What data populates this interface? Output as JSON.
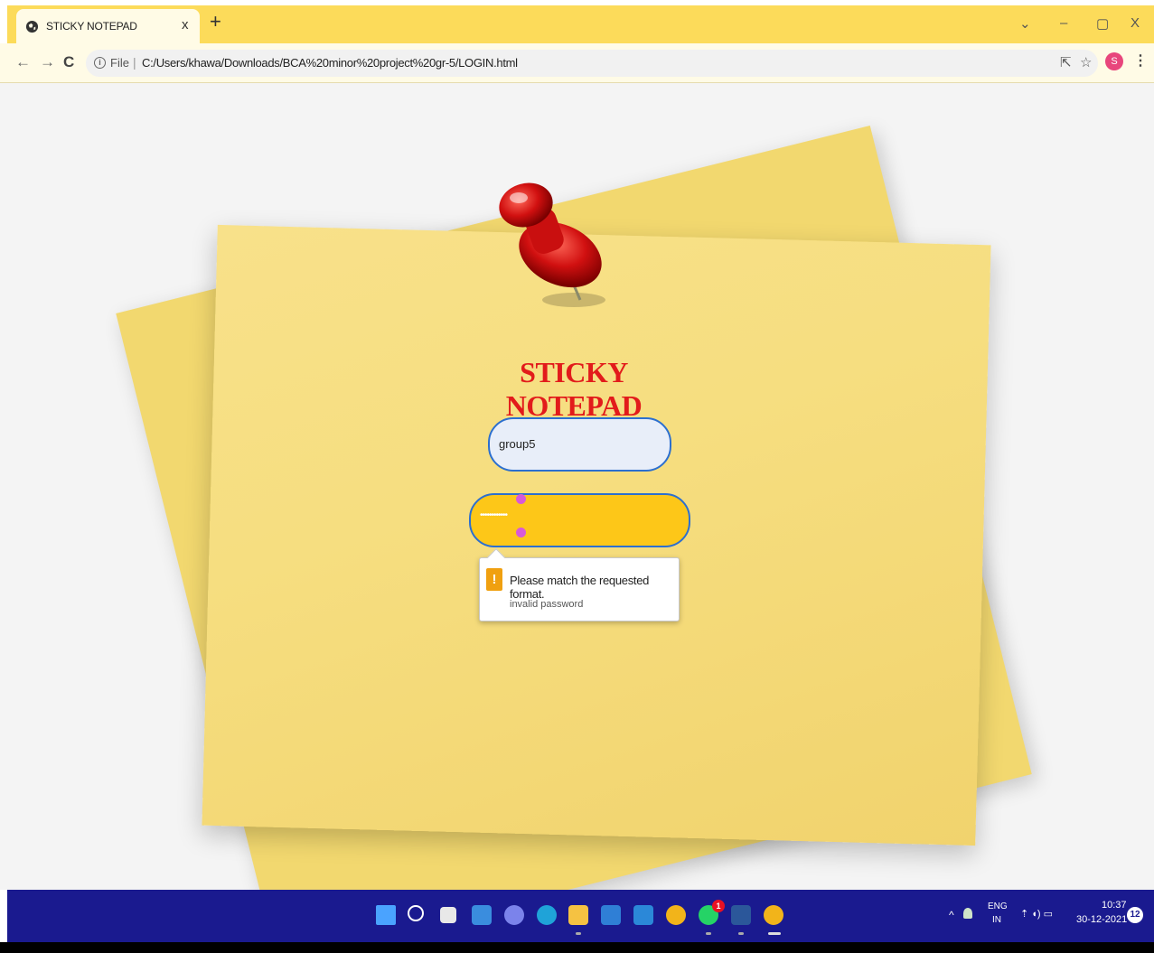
{
  "browser": {
    "tab": {
      "title": "STICKY NOTEPAD",
      "close": "x"
    },
    "new_tab": "+",
    "window_controls": {
      "dropdown": "⌄",
      "minimize": "–",
      "maximize": "▢",
      "close": "X"
    },
    "nav": {
      "back": "←",
      "forward": "→",
      "reload": "C"
    },
    "address": {
      "info": "i",
      "scheme": "File",
      "separator": "|",
      "path": "C:/Users/khawa/Downloads/BCA%20minor%20project%20gr-5/LOGIN.html"
    },
    "toolbar": {
      "share": "⇱",
      "bookmark": "☆",
      "profile": "S",
      "menu": "⋮"
    }
  },
  "page": {
    "title": "STICKY NOTEPAD",
    "username_value": "group5",
    "password_masked": "••••••••••••",
    "validation": {
      "message": "Please match the requested format.",
      "detail": "invalid password",
      "icon": "!"
    }
  },
  "taskbar": {
    "apps": [
      {
        "name": "start-icon",
        "color": "#4aa3ff"
      },
      {
        "name": "search-icon",
        "color": "#ffffff"
      },
      {
        "name": "task-view-icon",
        "color": "#ffffff"
      },
      {
        "name": "widgets-icon",
        "color": "#3a8dde"
      },
      {
        "name": "teams-chat-icon",
        "color": "#7b83eb"
      },
      {
        "name": "edge-icon",
        "color": "#1fa3d8"
      },
      {
        "name": "file-explorer-icon",
        "color": "#f5c242"
      },
      {
        "name": "store-icon",
        "color": "#2f7fd6"
      },
      {
        "name": "mail-icon",
        "color": "#2b88d8"
      },
      {
        "name": "chrome-icon",
        "color": "#f2b41a"
      },
      {
        "name": "whatsapp-icon",
        "color": "#25d366"
      },
      {
        "name": "word-icon",
        "color": "#2b579a"
      },
      {
        "name": "chrome-active-icon",
        "color": "#f2b41a"
      }
    ],
    "whatsapp_badge": "1",
    "tray": {
      "chevron": "^",
      "language_top": "ENG",
      "language_bottom": "IN",
      "status_icons": "⇡ ◖) ▭",
      "time": "10:37",
      "date": "30-12-2021",
      "notifications": "12"
    }
  }
}
